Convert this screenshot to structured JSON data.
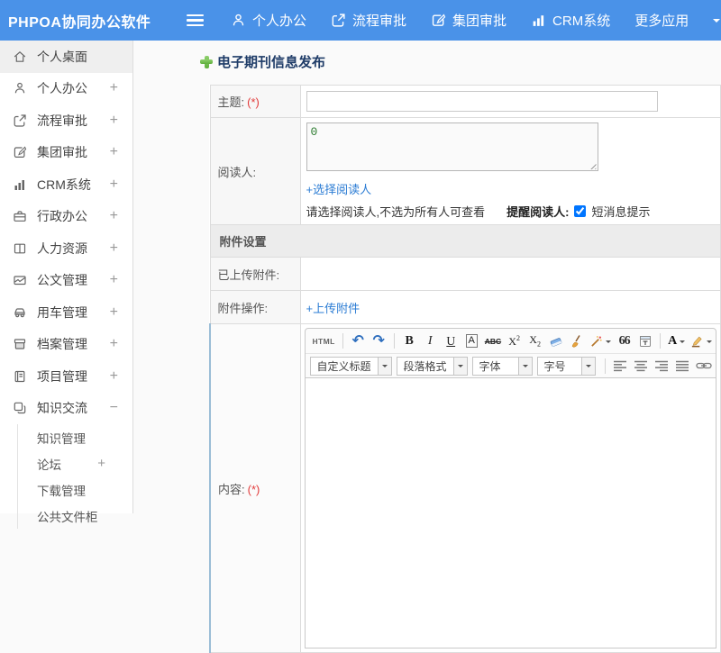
{
  "header": {
    "app_title": "PHPOA协同办公软件",
    "nav": [
      {
        "label": "个人办公"
      },
      {
        "label": "流程审批"
      },
      {
        "label": "集团审批"
      },
      {
        "label": "CRM系统"
      },
      {
        "label": "更多应用"
      }
    ]
  },
  "sidebar": {
    "items": [
      {
        "label": "个人桌面",
        "expand": ""
      },
      {
        "label": "个人办公",
        "expand": "+"
      },
      {
        "label": "流程审批",
        "expand": "+"
      },
      {
        "label": "集团审批",
        "expand": "+"
      },
      {
        "label": "CRM系统",
        "expand": "+"
      },
      {
        "label": "行政办公",
        "expand": "+"
      },
      {
        "label": "人力资源",
        "expand": "+"
      },
      {
        "label": "公文管理",
        "expand": "+"
      },
      {
        "label": "用车管理",
        "expand": "+"
      },
      {
        "label": "档案管理",
        "expand": "+"
      },
      {
        "label": "项目管理",
        "expand": "+"
      },
      {
        "label": "知识交流",
        "expand": "−"
      }
    ],
    "subitems": [
      {
        "label": "知识管理",
        "expand": ""
      },
      {
        "label": "论坛",
        "expand": "+"
      },
      {
        "label": "下载管理",
        "expand": ""
      },
      {
        "label": "公共文件柜",
        "expand": ""
      }
    ]
  },
  "page": {
    "title": "电子期刊信息发布"
  },
  "form": {
    "subject_label": "主题:",
    "subject_required": "(*)",
    "readers_label": "阅读人:",
    "readers_value": "0",
    "select_readers_link": "+选择阅读人",
    "readers_hint": "请选择阅读人,不选为所有人可查看",
    "remind_label": "提醒阅读人:",
    "sms_label": "短消息提示",
    "attachment_section_title": "附件设置",
    "uploaded_label": "已上传附件:",
    "operation_label": "附件操作:",
    "upload_link": "+上传附件",
    "content_label": "内容:",
    "content_required": "(*)"
  },
  "editor": {
    "html_button": "HTML",
    "undo_glyph": "↶",
    "redo_glyph": "↷",
    "bold": "B",
    "italic": "I",
    "underline": "U",
    "char_border": "A",
    "strike": "ABC",
    "sup_base": "X",
    "sup_mark": "2",
    "sub_base": "X",
    "sub_mark": "2",
    "quote": "66",
    "forecolor": "A",
    "selects": [
      {
        "label": "自定义标题"
      },
      {
        "label": "段落格式"
      },
      {
        "label": "字体"
      },
      {
        "label": "字号"
      }
    ]
  }
}
